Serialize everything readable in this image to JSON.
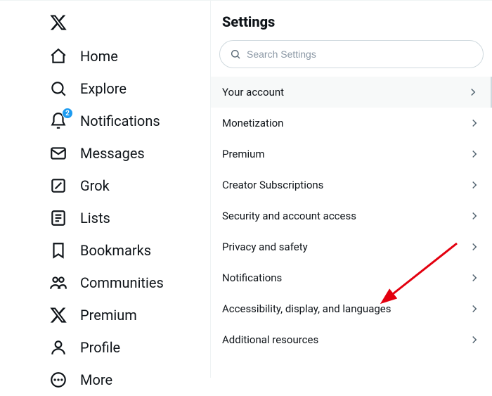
{
  "sidebar": {
    "items": [
      {
        "label": "Home"
      },
      {
        "label": "Explore"
      },
      {
        "label": "Notifications",
        "badge": "2"
      },
      {
        "label": "Messages"
      },
      {
        "label": "Grok"
      },
      {
        "label": "Lists"
      },
      {
        "label": "Bookmarks"
      },
      {
        "label": "Communities"
      },
      {
        "label": "Premium"
      },
      {
        "label": "Profile"
      },
      {
        "label": "More"
      }
    ]
  },
  "main": {
    "title": "Settings",
    "search_placeholder": "Search Settings",
    "items": [
      {
        "label": "Your account"
      },
      {
        "label": "Monetization"
      },
      {
        "label": "Premium"
      },
      {
        "label": "Creator Subscriptions"
      },
      {
        "label": "Security and account access"
      },
      {
        "label": "Privacy and safety"
      },
      {
        "label": "Notifications"
      },
      {
        "label": "Accessibility, display, and languages"
      },
      {
        "label": "Additional resources"
      }
    ]
  }
}
